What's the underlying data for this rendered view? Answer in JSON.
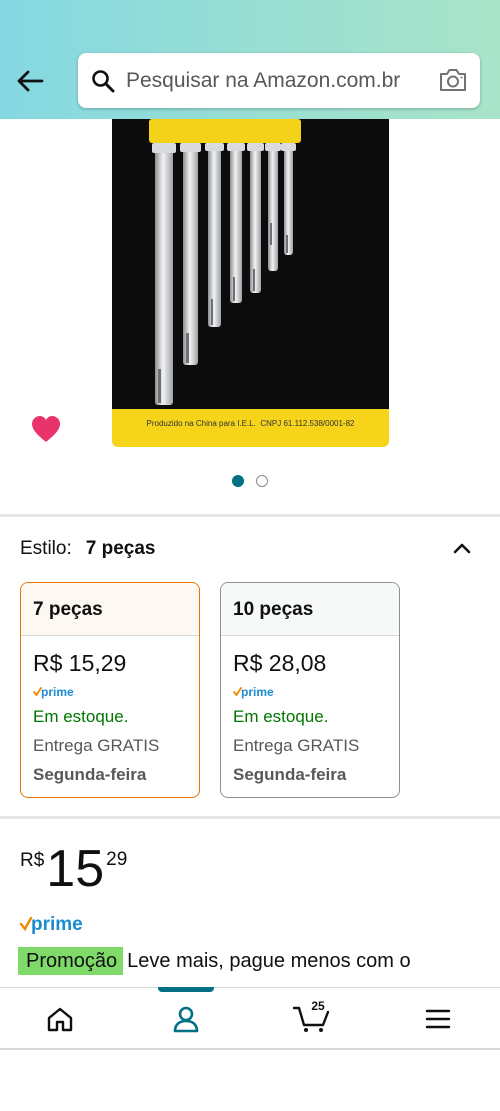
{
  "header": {
    "search_placeholder": "Pesquisar na Amazon.com.br"
  },
  "carousel": {
    "image_caption": "Produzido na China para I.E.L.  CNPJ 61.112.538/0001-82",
    "active_index": 0,
    "total": 2
  },
  "style": {
    "label": "Estilo:",
    "value": "7 peças",
    "options": [
      {
        "name": "7 peças",
        "price": "R$ 15,29",
        "prime": "prime",
        "stock": "Em estoque.",
        "shipping": "Entrega GRATIS",
        "delivery_day": "Segunda-feira"
      },
      {
        "name": "10 peças",
        "price": "R$ 28,08",
        "prime": "prime",
        "stock": "Em estoque.",
        "shipping": "Entrega GRATIS",
        "delivery_day": "Segunda-feira"
      }
    ]
  },
  "price": {
    "symbol": "R$",
    "whole": "15",
    "fraction": "29",
    "prime": "prime"
  },
  "promotion": {
    "badge": "Promoção",
    "text": "Leve mais, pague menos com o"
  },
  "bottom_nav": {
    "cart_count": "25",
    "active": "account"
  },
  "colors": {
    "accent": "#007185",
    "selected_border": "#e77600",
    "in_stock": "#007600",
    "promo_badge": "#7fda69",
    "heart": "#e8336b",
    "image_yellow": "#f5d41a"
  }
}
